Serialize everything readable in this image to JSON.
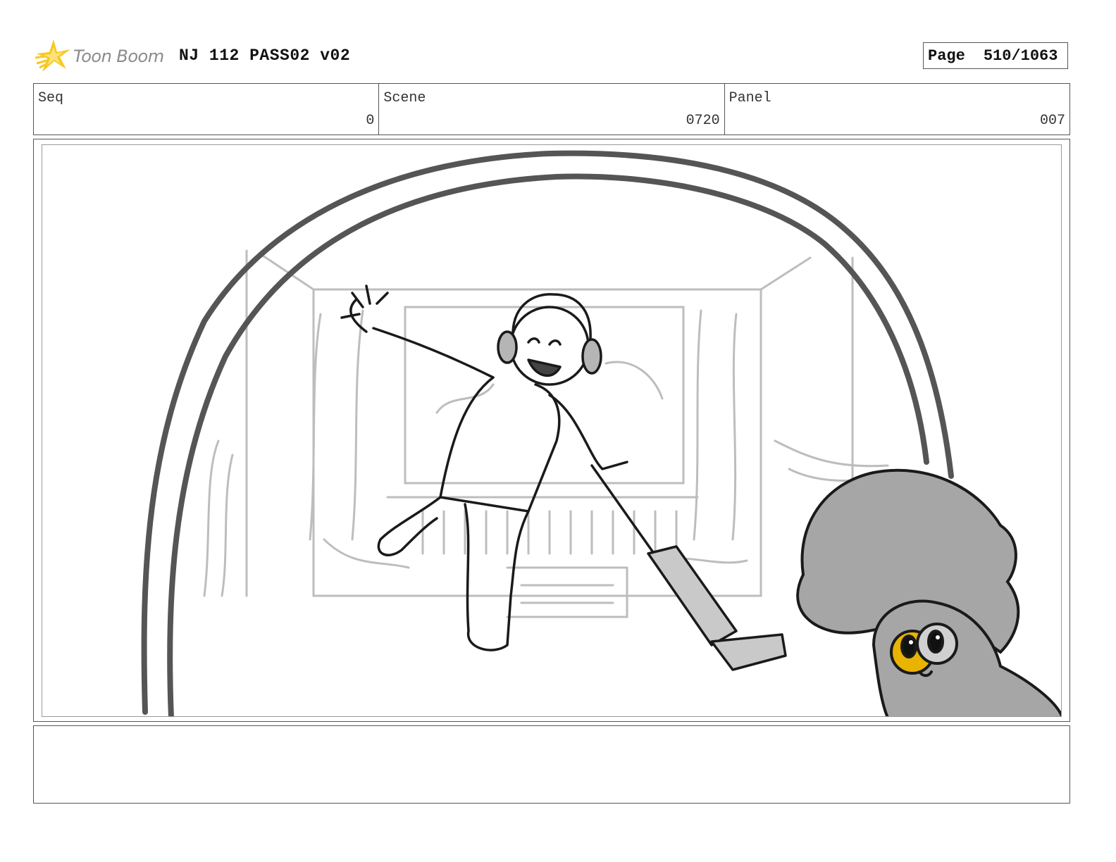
{
  "header": {
    "logo_text": "Toon Boom",
    "document_title": "NJ 112 PASS02 v02",
    "page_label": "Page",
    "page_value": "510/1063"
  },
  "info": {
    "seq_label": "Seq",
    "seq_value": "0",
    "scene_label": "Scene",
    "scene_value": "0720",
    "panel_label": "Panel",
    "panel_value": "007"
  },
  "notes": {
    "text": ""
  },
  "icons": {
    "logo": "toon-boom-star-icon"
  },
  "colors": {
    "logo_star": "#f7c81e",
    "logo_text": "#8a8a8a",
    "border": "#555555",
    "sketch_line": "#222222",
    "sketch_bg": "#bdbdbd",
    "tone_gray": "#a6a6a6",
    "highlight_yellow": "#e8b400"
  }
}
